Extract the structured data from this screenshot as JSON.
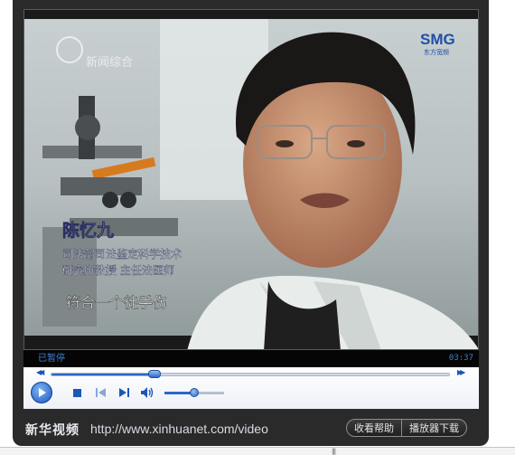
{
  "video": {
    "channel_logo": "新闻综合",
    "broadcaster": "SMG",
    "broadcaster_sub": "东方宽频",
    "caption_name": "陈忆九",
    "caption_title_1": "司法部司法鉴定科学技术",
    "caption_title_2": "研究所教授 主任法医师",
    "subtitle": "符合一个徒手伤"
  },
  "status": {
    "state": "已暂停",
    "time": "03:37"
  },
  "controls": {
    "seek_progress": 0.26,
    "volume_level": 0.5,
    "icons": [
      "rewind-icon",
      "fast-forward-icon",
      "play-icon",
      "stop-icon",
      "previous-track-icon",
      "next-track-icon",
      "speaker-icon"
    ]
  },
  "footer": {
    "brand": "新华视频",
    "url": "http://www.xinhuanet.com/video",
    "help_button": "收看帮助",
    "download_button": "播放器下载"
  },
  "colors": {
    "frame": "#2a2a2a",
    "accent": "#2d66c8",
    "status_text": "#3f7fd6",
    "broadcaster_logo": "#1f4fa8"
  }
}
